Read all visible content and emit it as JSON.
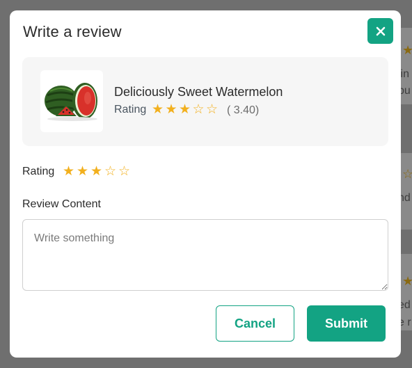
{
  "background": {
    "partial_texts": [
      "lin",
      "bu",
      "nd",
      "ed",
      "e r"
    ]
  },
  "modal": {
    "title": "Write a review",
    "close_icon": "close-icon"
  },
  "product": {
    "name": "Deliciously Sweet Watermelon",
    "image_icon": "watermelon-image",
    "rating_label": "Rating",
    "rating_value": 3.4,
    "rating_display": "( 3.40)",
    "max_stars": 5
  },
  "form": {
    "rating_label": "Rating",
    "rating_selected": 3,
    "max_stars": 5,
    "content_label": "Review Content",
    "content_value": "",
    "content_placeholder": "Write something",
    "cancel_label": "Cancel",
    "submit_label": "Submit"
  },
  "colors": {
    "accent": "#13a383",
    "star": "#f2b01e",
    "overlay": "#6f6f6f"
  }
}
